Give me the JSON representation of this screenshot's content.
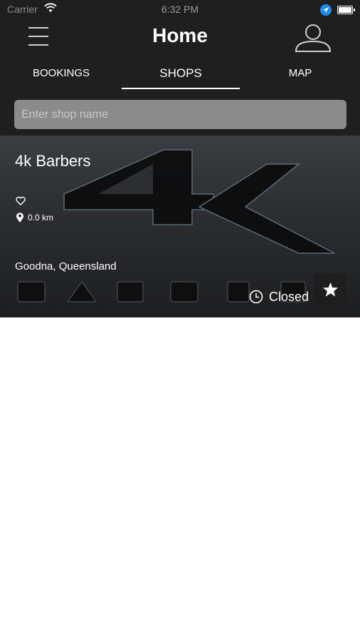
{
  "status_bar": {
    "carrier": "Carrier",
    "time": "6:32 PM"
  },
  "nav": {
    "title": "Home"
  },
  "tabs": [
    {
      "label": "BOOKINGS"
    },
    {
      "label": "SHOPS",
      "active": true
    },
    {
      "label": "MAP"
    }
  ],
  "search": {
    "placeholder": "Enter shop name",
    "value": ""
  },
  "shops": [
    {
      "name": "4k Barbers",
      "distance": "0.0 km",
      "location": "Goodna, Queensland",
      "status": "Closed",
      "logo_text": "BARBERS"
    }
  ],
  "colors": {
    "header_bg": "#1f1f1f",
    "search_bg": "#8b8b8b",
    "location_dot": "#1d8cf0"
  },
  "icons": [
    "menu-icon",
    "profile-icon",
    "heart-icon",
    "pin-icon",
    "clock-icon",
    "star-icon",
    "wifi-icon",
    "location-arrow-icon",
    "battery-icon"
  ]
}
